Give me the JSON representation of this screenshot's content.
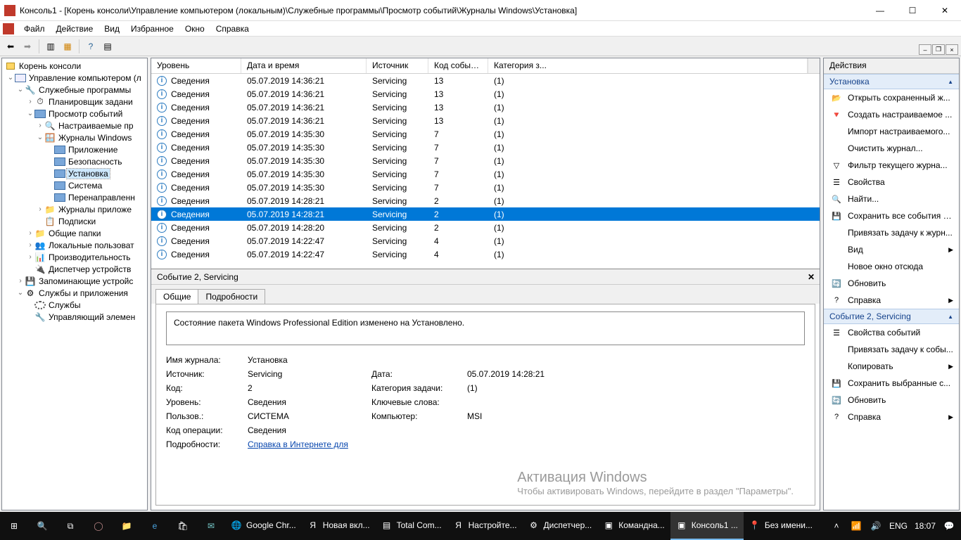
{
  "titlebar": {
    "title": "Консоль1 - [Корень консоли\\Управление компьютером (локальным)\\Служебные программы\\Просмотр событий\\Журналы Windows\\Установка]"
  },
  "menu": {
    "file": "Файл",
    "action": "Действие",
    "view": "Вид",
    "favorites": "Избранное",
    "window": "Окно",
    "help": "Справка"
  },
  "tree": {
    "root": "Корень консоли",
    "mgmt": "Управление компьютером (л",
    "util": "Служебные программы",
    "sched": "Планировщик задани",
    "eventviewer": "Просмотр событий",
    "customviews": "Настраиваемые пр",
    "winlogs": "Журналы Windows",
    "app": "Приложение",
    "security": "Безопасность",
    "setup": "Установка",
    "system": "Система",
    "forwarded": "Перенаправленн",
    "applogs": "Журналы приложе",
    "subs": "Подписки",
    "shared": "Общие папки",
    "users": "Локальные пользоват",
    "perf": "Производительность",
    "devmgr": "Диспетчер устройств",
    "storage": "Запоминающие устройс",
    "services_apps": "Службы и приложения",
    "services": "Службы",
    "wmi": "Управляющий элемен"
  },
  "columns": {
    "level": "Уровень",
    "datetime": "Дата и время",
    "source": "Источник",
    "eventid": "Код события",
    "category": "Категория з..."
  },
  "events": [
    {
      "level": "Сведения",
      "dt": "05.07.2019 14:36:21",
      "src": "Servicing",
      "id": "13",
      "cat": "(1)"
    },
    {
      "level": "Сведения",
      "dt": "05.07.2019 14:36:21",
      "src": "Servicing",
      "id": "13",
      "cat": "(1)"
    },
    {
      "level": "Сведения",
      "dt": "05.07.2019 14:36:21",
      "src": "Servicing",
      "id": "13",
      "cat": "(1)"
    },
    {
      "level": "Сведения",
      "dt": "05.07.2019 14:36:21",
      "src": "Servicing",
      "id": "13",
      "cat": "(1)"
    },
    {
      "level": "Сведения",
      "dt": "05.07.2019 14:35:30",
      "src": "Servicing",
      "id": "7",
      "cat": "(1)"
    },
    {
      "level": "Сведения",
      "dt": "05.07.2019 14:35:30",
      "src": "Servicing",
      "id": "7",
      "cat": "(1)"
    },
    {
      "level": "Сведения",
      "dt": "05.07.2019 14:35:30",
      "src": "Servicing",
      "id": "7",
      "cat": "(1)"
    },
    {
      "level": "Сведения",
      "dt": "05.07.2019 14:35:30",
      "src": "Servicing",
      "id": "7",
      "cat": "(1)"
    },
    {
      "level": "Сведения",
      "dt": "05.07.2019 14:35:30",
      "src": "Servicing",
      "id": "7",
      "cat": "(1)"
    },
    {
      "level": "Сведения",
      "dt": "05.07.2019 14:28:21",
      "src": "Servicing",
      "id": "2",
      "cat": "(1)"
    },
    {
      "level": "Сведения",
      "dt": "05.07.2019 14:28:21",
      "src": "Servicing",
      "id": "2",
      "cat": "(1)",
      "selected": true
    },
    {
      "level": "Сведения",
      "dt": "05.07.2019 14:28:20",
      "src": "Servicing",
      "id": "2",
      "cat": "(1)"
    },
    {
      "level": "Сведения",
      "dt": "05.07.2019 14:22:47",
      "src": "Servicing",
      "id": "4",
      "cat": "(1)"
    },
    {
      "level": "Сведения",
      "dt": "05.07.2019 14:22:47",
      "src": "Servicing",
      "id": "4",
      "cat": "(1)"
    }
  ],
  "details": {
    "header": "Событие 2, Servicing",
    "tab_general": "Общие",
    "tab_details": "Подробности",
    "message": "Состояние пакета Windows Professional Edition изменено на Установлено.",
    "labels": {
      "logname": "Имя журнала:",
      "source": "Источник:",
      "code": "Код:",
      "level": "Уровень:",
      "user": "Пользов.:",
      "opcode": "Код операции:",
      "more": "Подробности:",
      "date": "Дата:",
      "taskcat": "Категория задачи:",
      "keywords": "Ключевые слова:",
      "computer": "Компьютер:"
    },
    "values": {
      "logname": "Установка",
      "source": "Servicing",
      "code": "2",
      "level": "Сведения",
      "user": "СИСТЕМА",
      "opcode": "Сведения",
      "date": "05.07.2019 14:28:21",
      "taskcat": "(1)",
      "keywords": "",
      "computer": "MSI",
      "morelink": "Справка в Интернете для"
    }
  },
  "actions": {
    "header": "Действия",
    "sec1": "Установка",
    "items1": [
      "Открыть сохраненный ж...",
      "Создать настраиваемое ...",
      "Импорт настраиваемого...",
      "Очистить журнал...",
      "Фильтр текущего журна...",
      "Свойства",
      "Найти...",
      "Сохранить все события к...",
      "Привязать задачу к журн...",
      "Вид",
      "Новое окно отсюда",
      "Обновить",
      "Справка"
    ],
    "sec2": "Событие 2, Servicing",
    "items2": [
      "Свойства событий",
      "Привязать задачу к собы...",
      "Копировать",
      "Сохранить выбранные с...",
      "Обновить",
      "Справка"
    ]
  },
  "watermark": {
    "line1": "Активация Windows",
    "line2": "Чтобы активировать Windows, перейдите в раздел \"Параметры\"."
  },
  "taskbar": {
    "items": [
      {
        "label": "Google Chr...",
        "icon": "🌐"
      },
      {
        "label": "Новая вкл...",
        "icon": "Я"
      },
      {
        "label": "Total Com...",
        "icon": "▤"
      },
      {
        "label": "Настройте...",
        "icon": "Я"
      },
      {
        "label": "Диспетчер...",
        "icon": "⚙"
      },
      {
        "label": "Командна...",
        "icon": "▣"
      },
      {
        "label": "Консоль1 ...",
        "icon": "▣",
        "active": true
      },
      {
        "label": "Без имени...",
        "icon": "📍"
      }
    ],
    "lang": "ENG",
    "time": "18:07"
  }
}
